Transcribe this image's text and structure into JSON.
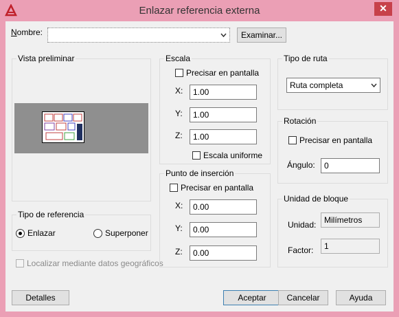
{
  "window": {
    "title": "Enlazar referencia externa",
    "close": "✕"
  },
  "nombre": {
    "label": "Nombre:",
    "value": "",
    "browse": "Examinar..."
  },
  "vista": {
    "title": "Vista preliminar"
  },
  "escala": {
    "title": "Escala",
    "precisar": "Precisar en pantalla",
    "x_label": "X:",
    "x": "1.00",
    "y_label": "Y:",
    "y": "1.00",
    "z_label": "Z:",
    "z": "1.00",
    "uniforme": "Escala uniforme"
  },
  "insercion": {
    "title": "Punto de inserción",
    "precisar": "Precisar en pantalla",
    "x_label": "X:",
    "x": "0.00",
    "y_label": "Y:",
    "y": "0.00",
    "z_label": "Z:",
    "z": "0.00"
  },
  "ruta": {
    "title": "Tipo de ruta",
    "value": "Ruta completa"
  },
  "rotacion": {
    "title": "Rotación",
    "precisar": "Precisar en pantalla",
    "angulo_label": "Ángulo:",
    "angulo": "0"
  },
  "unidad": {
    "title": "Unidad de bloque",
    "unidad_label": "Unidad:",
    "unidad": "Milímetros",
    "factor_label": "Factor:",
    "factor": "1"
  },
  "tipo_ref": {
    "title": "Tipo de referencia",
    "enlazar": "Enlazar",
    "superponer": "Superponer"
  },
  "geo": {
    "label": "Localizar mediante datos geográficos"
  },
  "buttons": {
    "detalles": "Detalles",
    "aceptar": "Aceptar",
    "cancelar": "Cancelar",
    "ayuda": "Ayuda"
  },
  "colors": {
    "titlebar": "#eb9fb5",
    "close": "#c7414a",
    "preview_bg": "#8f8f8f"
  }
}
